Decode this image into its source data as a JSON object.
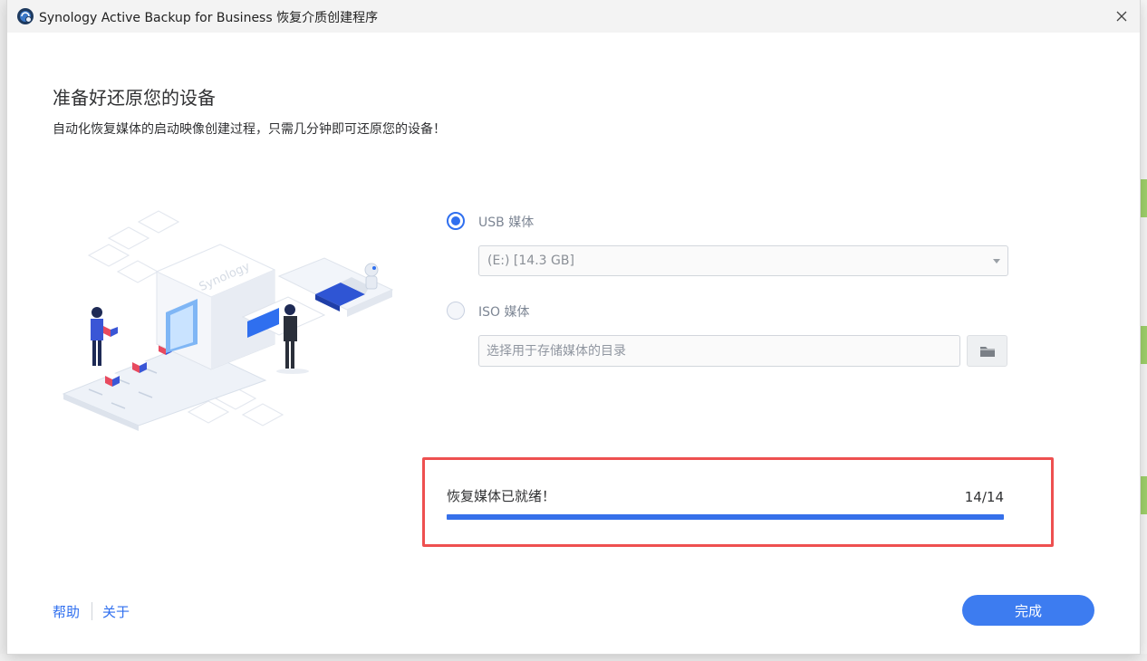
{
  "window": {
    "title": "Synology Active Backup for Business 恢复介质创建程序"
  },
  "page": {
    "heading": "准备好还原您的设备",
    "subheading": "自动化恢复媒体的启动映像创建过程，只需几分钟即可还原您的设备！"
  },
  "illustration": {
    "brand_text": "Synology"
  },
  "options": {
    "usb_label": "USB 媒体",
    "usb_selected": true,
    "usb_drive_value": "(E:) [14.3 GB]",
    "iso_label": "ISO 媒体",
    "iso_selected": false,
    "iso_dir_placeholder": "选择用于存储媒体的目录"
  },
  "progress": {
    "status_text": "恢复媒体已就绪！",
    "count": "14/14",
    "fraction": 1.0
  },
  "footer": {
    "help_label": "帮助",
    "about_label": "关于",
    "finish_label": "完成"
  },
  "colors": {
    "accent": "#2f6fef",
    "progress": "#3670ea",
    "highlight_border": "#ee5050"
  }
}
